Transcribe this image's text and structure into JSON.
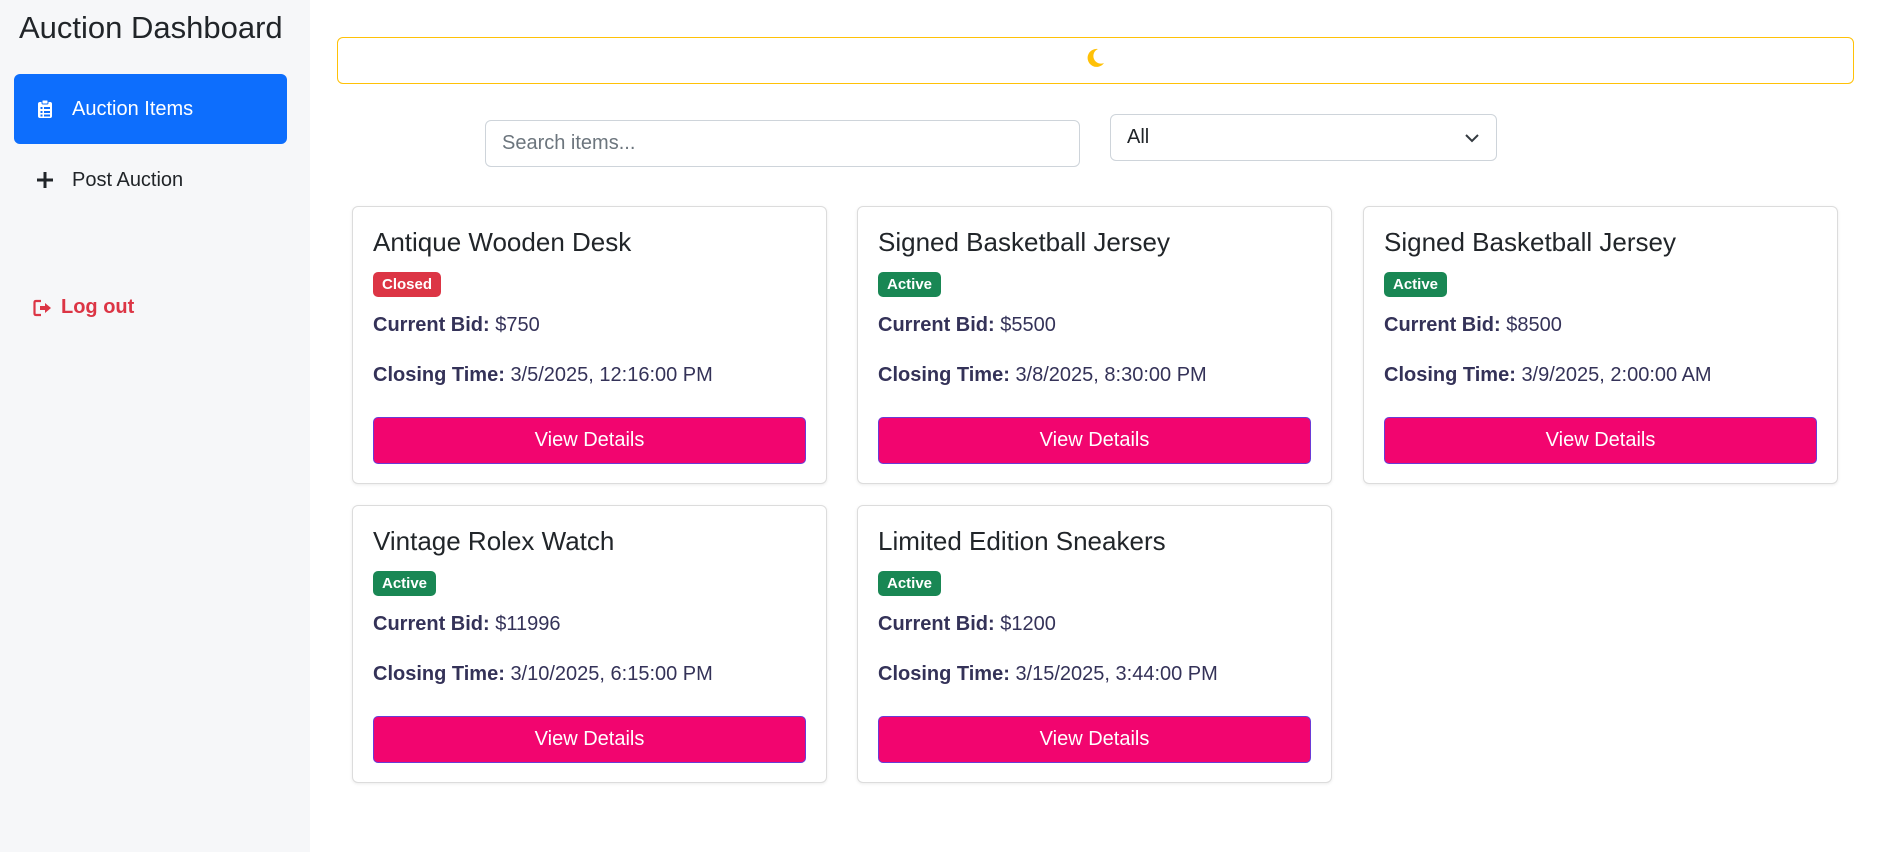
{
  "sidebar": {
    "title": "Auction Dashboard",
    "items": [
      {
        "label": "Auction Items",
        "icon": "clipboard-icon",
        "active": true
      },
      {
        "label": "Post Auction",
        "icon": "plus-icon",
        "active": false
      }
    ],
    "logout_label": "Log out"
  },
  "theme_toggle": {
    "icon": "moon-icon",
    "color": "#ffc107"
  },
  "search": {
    "placeholder": "Search items...",
    "value": ""
  },
  "filter": {
    "selected": "All"
  },
  "labels": {
    "current_bid": "Current Bid:",
    "closing_time": "Closing Time:",
    "view_details": "View Details"
  },
  "items": [
    {
      "title": "Antique Wooden Desk",
      "status": "Closed",
      "bid": "$750",
      "closing": "3/5/2025, 12:16:00 PM"
    },
    {
      "title": "Signed Basketball Jersey",
      "status": "Active",
      "bid": "$5500",
      "closing": "3/8/2025, 8:30:00 PM"
    },
    {
      "title": "Signed Basketball Jersey",
      "status": "Active",
      "bid": "$8500",
      "closing": "3/9/2025, 2:00:00 AM"
    },
    {
      "title": "Vintage Rolex Watch",
      "status": "Active",
      "bid": "$11996",
      "closing": "3/10/2025, 6:15:00 PM"
    },
    {
      "title": "Limited Edition Sneakers",
      "status": "Active",
      "bid": "$1200",
      "closing": "3/15/2025, 3:44:00 PM"
    }
  ],
  "colors": {
    "primary": "#0d6efd",
    "danger": "#dc3545",
    "success": "#198754",
    "button": "#f2056f",
    "warning": "#ffc107"
  }
}
